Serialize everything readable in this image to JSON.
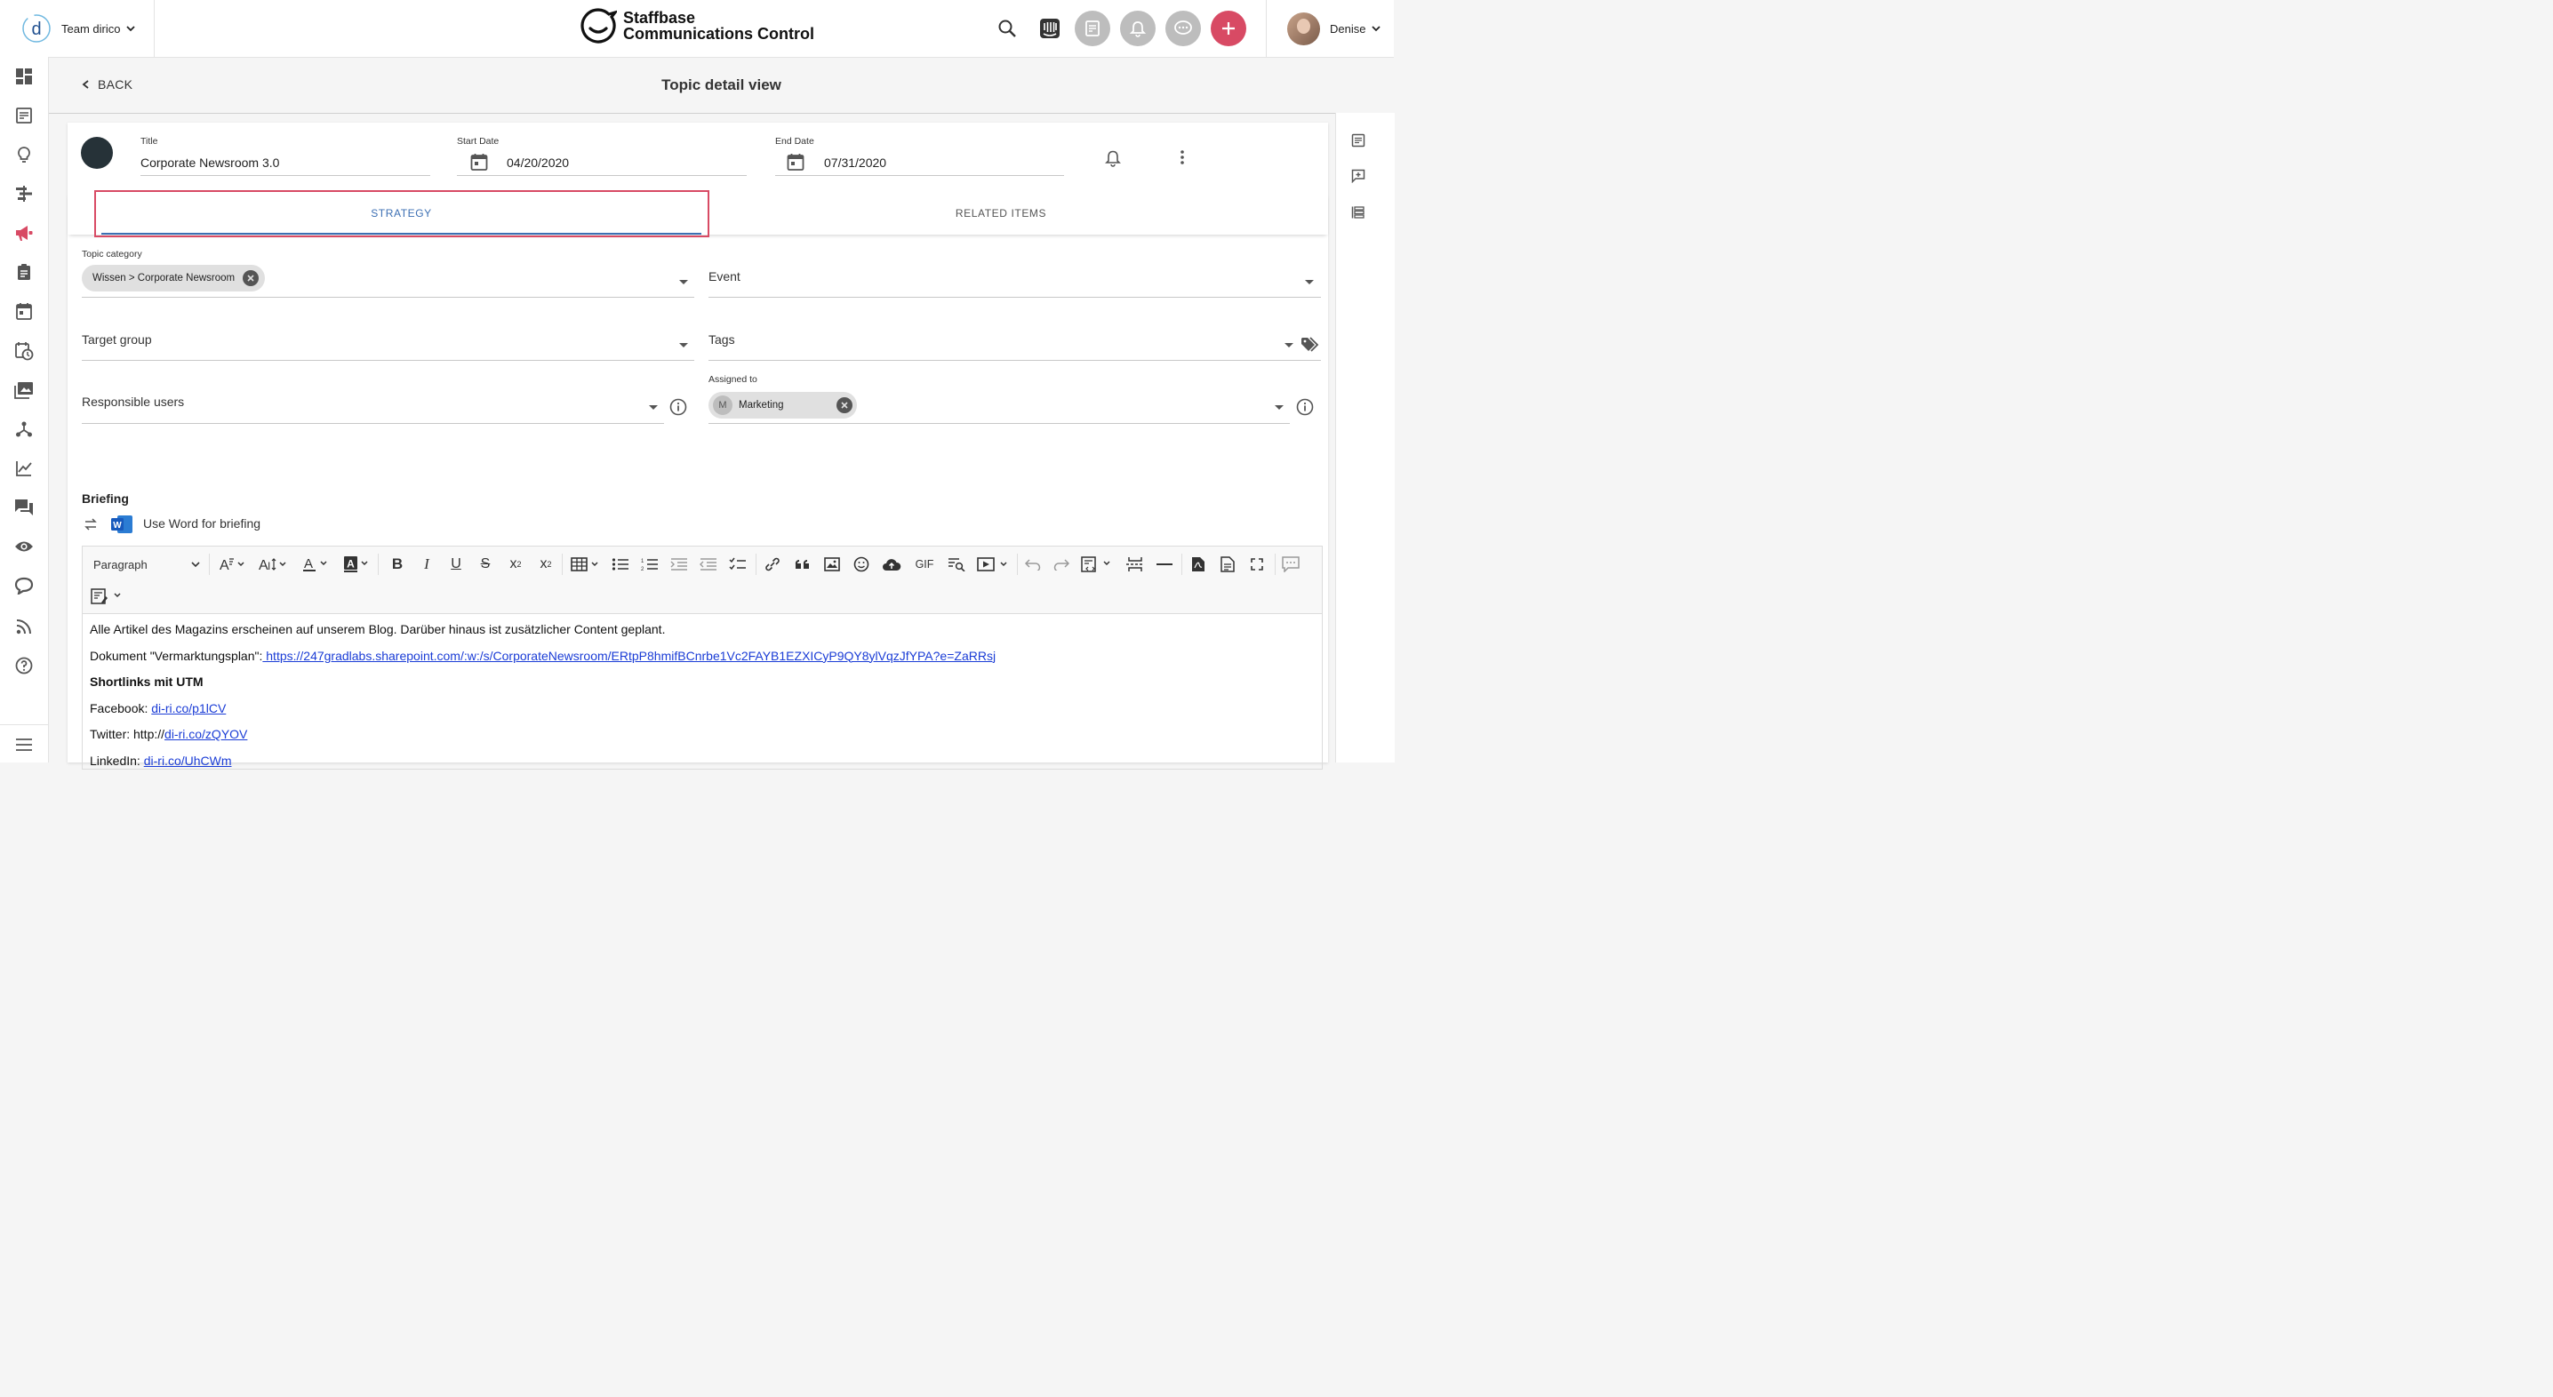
{
  "header": {
    "team_name": "Team dirico",
    "brand_line1": "Staffbase",
    "brand_line2": "Communications Control",
    "user_name": "Denise",
    "accent_color": "#d84a64"
  },
  "sidebar": {
    "items": [
      "dashboard-icon",
      "content-list-icon",
      "idea-lightbulb-icon",
      "gantt-icon",
      "megaphone-icon",
      "clipboard-icon",
      "calendar-icon",
      "schedule-icon",
      "media-library-icon",
      "network-icon",
      "analytics-icon",
      "chat-icon",
      "visibility-eye-icon",
      "message-bubble-icon",
      "rss-feed-icon",
      "help-icon",
      "menu-icon"
    ]
  },
  "subheader": {
    "back_label": "BACK",
    "page_title": "Topic detail view"
  },
  "topic": {
    "title_label": "Title",
    "title_value": "Corporate Newsroom 3.0",
    "start_label": "Start Date",
    "start_value": "04/20/2020",
    "end_label": "End Date",
    "end_value": "07/31/2020"
  },
  "tabs": {
    "strategy": "STRATEGY",
    "related": "RELATED ITEMS"
  },
  "strategy": {
    "topic_category_label": "Topic category",
    "topic_category_chip": "Wissen > Corporate Newsroom",
    "event_label": "Event",
    "target_group_label": "Target group",
    "tags_label": "Tags",
    "responsible_label": "Responsible users",
    "assigned_label": "Assigned to",
    "assigned_chip_initial": "M",
    "assigned_chip": "Marketing"
  },
  "briefing": {
    "title": "Briefing",
    "word_label": "Use Word for briefing",
    "paragraph_select": "Paragraph",
    "gif_label": "GIF",
    "line1": "Alle Artikel des Magazins erscheinen auf unserem Blog. Darüber hinaus ist zusätzlicher Content geplant.",
    "line2_prefix": "Dokument \"Vermarktungsplan\":",
    "line2_link": " https://247gradlabs.sharepoint.com/:w:/s/CorporateNewsroom/ERtpP8hmifBCnrbe1Vc2FAYB1EZXICyP9QY8ylVqzJfYPA?e=ZaRRsj",
    "line3": "Shortlinks mit UTM",
    "line4_prefix": "Facebook: ",
    "line4_link": "di-ri.co/p1lCV",
    "line5_prefix": "Twitter: http://",
    "line5_link": "di-ri.co/zQYOV",
    "line6_prefix": "LinkedIn: ",
    "line6_link": "di-ri.co/UhCWm"
  }
}
